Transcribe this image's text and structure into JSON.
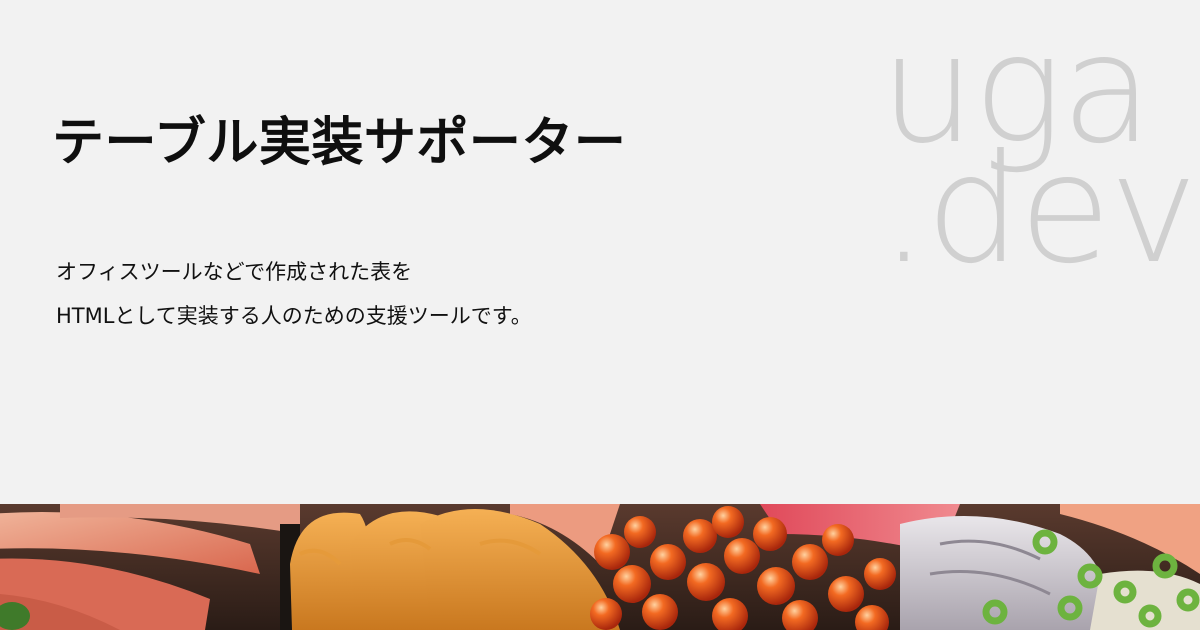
{
  "title": "テーブル実装サポーター",
  "description": {
    "line1": "オフィスツールなどで作成された表を",
    "line2": "HTMLとして実装する人のための支援ツールです。"
  },
  "brand": {
    "line1": "uga",
    "line2": ".dev"
  },
  "colors": {
    "background": "#f2f2f2",
    "title": "#0f0f0f",
    "brand": "#d0d0d0"
  }
}
